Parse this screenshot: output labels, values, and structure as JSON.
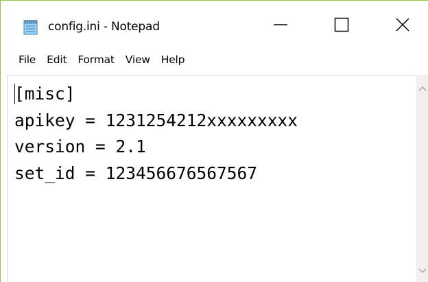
{
  "window": {
    "title": "config.ini - Notepad",
    "icon": "notepad-icon",
    "controls": [
      "minimize-icon",
      "maximize-icon",
      "close-icon"
    ]
  },
  "menu": {
    "items": [
      "File",
      "Edit",
      "Format",
      "View",
      "Help"
    ]
  },
  "editor": {
    "lines": [
      "[misc]",
      "apikey = 1231254212xxxxxxxxx",
      "version = 2.1",
      "set_id = 123456676567567"
    ]
  },
  "scrollbar": {
    "icons": [
      "scroll-up-arrow-icon",
      "scroll-down-arrow-icon"
    ]
  },
  "colors": {
    "border_accent": "#8dc63f",
    "scrollbar_bg": "#f0f0f0",
    "arrow": "#a6a6a6"
  }
}
